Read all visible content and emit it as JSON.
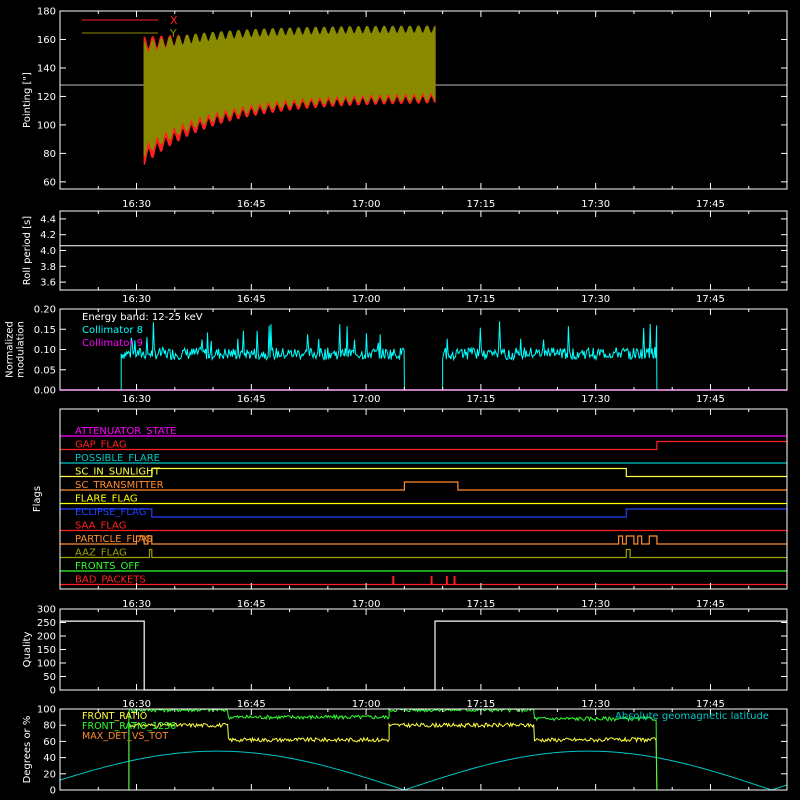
{
  "chart_data": [
    {
      "type": "line",
      "ylabel": "Pointing [\"]",
      "ylim": [
        55,
        180
      ],
      "yticks": [
        60,
        80,
        100,
        120,
        140,
        160,
        180
      ],
      "xtick_labels": [
        "16:30",
        "16:45",
        "17:00",
        "17:15",
        "17:30",
        "17:45"
      ],
      "legend": [
        {
          "name": "X",
          "color": "#ff2020"
        },
        {
          "name": "Y",
          "color": "#8a8a00"
        }
      ],
      "series": [
        {
          "name": "X",
          "t_range": [
            "16:31",
            "17:09"
          ],
          "envelope_start": [
            72,
            162
          ],
          "envelope_end": [
            116,
            165
          ],
          "color": "#ff2020"
        },
        {
          "name": "Y",
          "t_range": [
            "16:31",
            "17:09"
          ],
          "envelope_start": [
            78,
            158
          ],
          "envelope_end": [
            118,
            170
          ],
          "color": "#8a8a00"
        }
      ],
      "reference_line": 128
    },
    {
      "type": "line",
      "ylabel": "Roll period [s]",
      "ylim": [
        3.5,
        4.5
      ],
      "yticks": [
        "3.6",
        "3.8",
        "4.0",
        "4.2",
        "4.4"
      ],
      "xtick_labels": [
        "16:30",
        "16:45",
        "17:00",
        "17:15",
        "17:30",
        "17:45"
      ],
      "series": [
        {
          "name": "roll",
          "value": 4.06,
          "color": "#ffffff"
        }
      ]
    },
    {
      "type": "line",
      "ylabel": "Normalized modulation",
      "ylim": [
        0,
        0.2
      ],
      "yticks": [
        "0.00",
        "0.05",
        "0.10",
        "0.15",
        "0.20"
      ],
      "xtick_labels": [
        "16:30",
        "16:45",
        "17:00",
        "17:15",
        "17:30",
        "17:45"
      ],
      "annotations": [
        "Energy band: 12-25 keV"
      ],
      "legend": [
        {
          "name": "Collimator 8",
          "color": "#00ffff"
        },
        {
          "name": "Collimator 9",
          "color": "#ff00ff"
        }
      ],
      "series": [
        {
          "name": "Collimator 8",
          "segments": [
            [
              "16:28",
              "17:05"
            ],
            [
              "17:10",
              "17:38"
            ]
          ],
          "mean": 0.09,
          "color": "#00ffff"
        },
        {
          "name": "Collimator 9",
          "value": 0.0,
          "color": "#ff00ff"
        }
      ]
    },
    {
      "type": "line",
      "ylabel": "Flags",
      "xtick_labels": [
        "16:30",
        "16:45",
        "17:00",
        "17:15",
        "17:30",
        "17:45"
      ],
      "flags": [
        {
          "name": "ATTENUATOR_STATE",
          "color": "#ff00ff",
          "on": []
        },
        {
          "name": "GAP_FLAG",
          "color": "#ff2020",
          "on": [
            [
              "17:38",
              "17:55"
            ]
          ]
        },
        {
          "name": "POSSIBLE_FLARE",
          "color": "#00c8c8",
          "on": []
        },
        {
          "name": "SC_IN_SUNLIGHT",
          "color": "#ffff40",
          "on": [
            [
              "16:32",
              "17:34"
            ]
          ]
        },
        {
          "name": "SC_TRANSMITTER",
          "color": "#ff8c30",
          "on": [
            [
              "17:05",
              "17:12"
            ]
          ]
        },
        {
          "name": "FLARE_FLAG",
          "color": "#ffff00",
          "on": []
        },
        {
          "name": "ECLIPSE_FLAG",
          "color": "#2040ff",
          "on": [
            [
              "16:20",
              "16:32"
            ],
            [
              "17:34",
              "17:55"
            ]
          ]
        },
        {
          "name": "SAA_FLAG",
          "color": "#ff2020",
          "on": []
        },
        {
          "name": "PARTICLE_FLAG",
          "color": "#ff8c30",
          "on": [
            [
              "16:30",
              "16:31"
            ],
            [
              "16:31.5",
              "16:32"
            ],
            [
              "17:33",
              "17:33.5"
            ],
            [
              "17:34",
              "17:35"
            ],
            [
              "17:35.5",
              "17:36"
            ],
            [
              "17:37",
              "17:38"
            ]
          ]
        },
        {
          "name": "AAZ_FLAG",
          "color": "#a0a000",
          "on": [
            [
              "16:31.7",
              "16:32"
            ],
            [
              "17:34",
              "17:34.5"
            ]
          ]
        },
        {
          "name": "FRONTS_OFF",
          "color": "#30ff30",
          "on": []
        },
        {
          "name": "BAD_PACKETS",
          "color": "#ff2020",
          "on": [
            [
              "17:03.5",
              "17:03.6"
            ],
            [
              "17:08.5",
              "17:08.6"
            ],
            [
              "17:10.5",
              "17:10.6"
            ],
            [
              "17:11.5",
              "17:11.6"
            ]
          ]
        }
      ]
    },
    {
      "type": "line",
      "ylabel": "Quality",
      "ylim": [
        0,
        300
      ],
      "yticks": [
        0,
        50,
        100,
        150,
        200,
        250,
        300
      ],
      "xtick_labels": [
        "16:30",
        "16:45",
        "17:00",
        "17:15",
        "17:30",
        "17:45"
      ],
      "series": [
        {
          "name": "quality",
          "segments": [
            {
              "t": [
                "16:20",
                "16:31"
              ],
              "value": 255
            },
            {
              "t": [
                "16:31",
                "17:09"
              ],
              "value": 0
            },
            {
              "t": [
                "17:09",
                "17:55"
              ],
              "value": 255
            }
          ],
          "color": "#ffffff"
        }
      ]
    },
    {
      "type": "line",
      "ylabel": "Degrees or %",
      "ylim": [
        0,
        100
      ],
      "yticks": [
        0,
        20,
        40,
        60,
        80,
        100
      ],
      "xtick_labels": [],
      "legend": [
        {
          "name": "FRONT_RATIO",
          "color": "#ffff40"
        },
        {
          "name": "FRONT_RATIO_1236",
          "color": "#30ff30"
        },
        {
          "name": "MAX_DET_VS_TOT",
          "color": "#ff8c30"
        },
        {
          "name": "Absolute geomagnetic latitude",
          "color": "#00c8c8"
        }
      ],
      "series": [
        {
          "name": "FRONT_RATIO",
          "levels": [
            [
              "16:29",
              "16:42",
              80
            ],
            [
              "16:42",
              "17:03",
              62
            ],
            [
              "17:03",
              "17:22",
              80
            ],
            [
              "17:22",
              "17:38",
              62
            ]
          ],
          "color": "#ffff40"
        },
        {
          "name": "FRONT_RATIO_1236",
          "levels": [
            [
              "16:29",
              "16:42",
              99
            ],
            [
              "16:42",
              "17:03",
              90
            ],
            [
              "17:03",
              "17:22",
              99
            ],
            [
              "17:22",
              "17:38",
              88
            ]
          ],
          "color": "#30ff30"
        },
        {
          "name": "Absolute geomagnetic latitude",
          "amplitude": 48,
          "zeros": [
            "16:16",
            "17:05",
            "17:53"
          ],
          "color": "#00c8c8"
        }
      ]
    }
  ]
}
